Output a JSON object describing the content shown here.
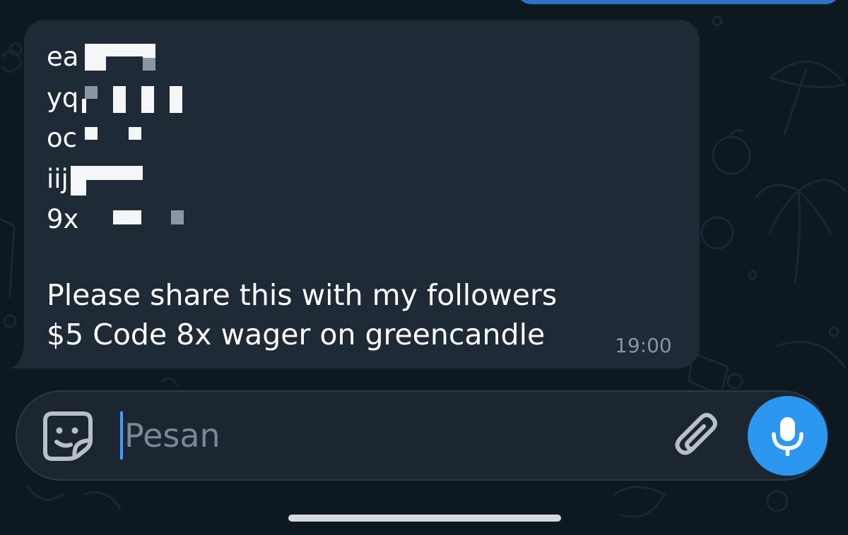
{
  "chat": {
    "incoming_message": {
      "redacted_prefixes": [
        "ea",
        "yq",
        "oc",
        "iij",
        "9x"
      ],
      "line1": "Please share this with my followers",
      "line2": "$5 Code 8x wager on greencandle",
      "time": "19:00"
    }
  },
  "composer": {
    "placeholder": "Pesan",
    "icons": {
      "left": "sticker-icon",
      "attach": "paperclip-icon",
      "send": "microphone-icon"
    }
  },
  "colors": {
    "background": "#0e1821",
    "bubble": "#1e2a36",
    "accent": "#2c97f0",
    "sent_bubble": "#2f73c8",
    "timestamp": "#8794a2"
  }
}
